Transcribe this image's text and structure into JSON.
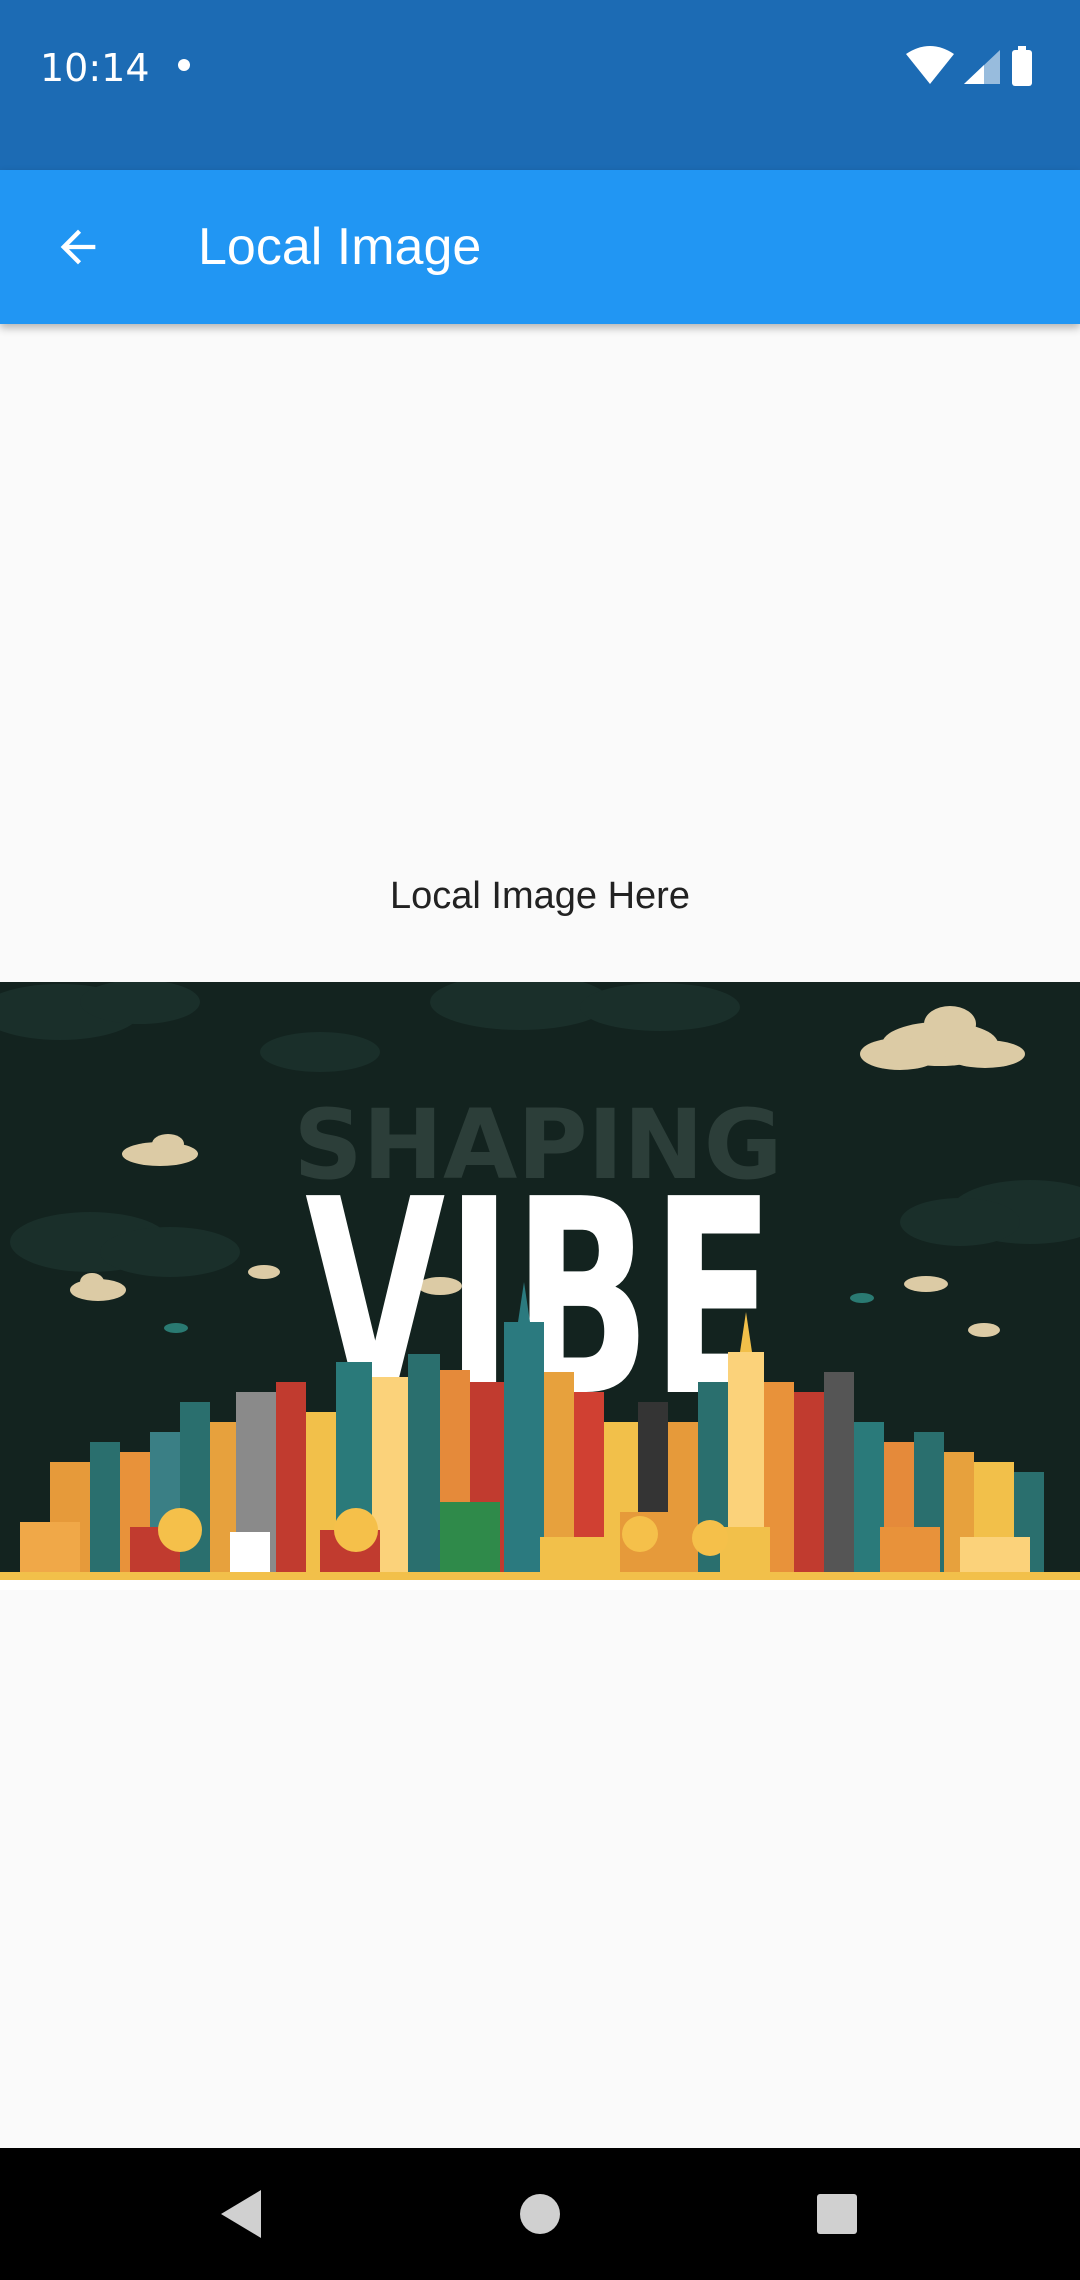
{
  "status_bar": {
    "time": "10:14",
    "background": "#1c6bb4"
  },
  "app_bar": {
    "title": "Local Image",
    "background": "#2196f3",
    "back_icon": "arrow-back-icon"
  },
  "content": {
    "caption": "Local Image Here",
    "image": {
      "overlay_text_top": "SHAPING",
      "overlay_text_main": "VIBE"
    }
  },
  "nav_bar": {
    "icons": [
      "back-triangle-icon",
      "home-circle-icon",
      "recents-square-icon"
    ]
  }
}
